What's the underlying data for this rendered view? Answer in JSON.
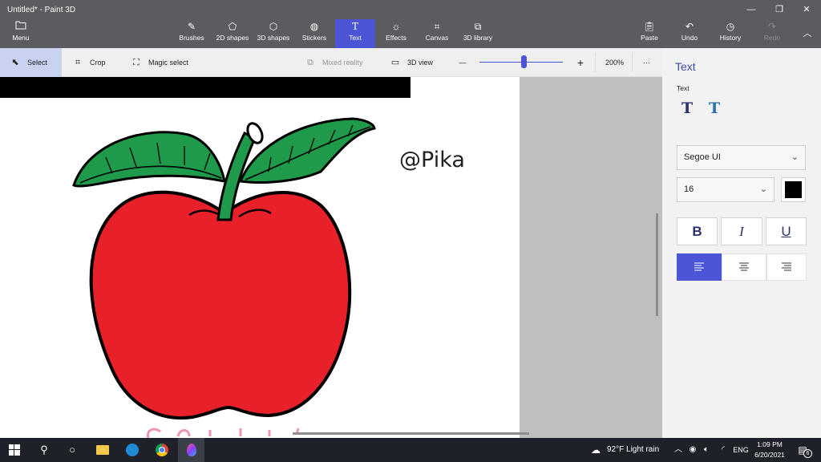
{
  "app": {
    "title": "Untitled* - Paint 3D"
  },
  "menu": {
    "label": "Menu",
    "icon": "folder-icon"
  },
  "tools": [
    {
      "label": "Brushes",
      "icon": "brush-icon"
    },
    {
      "label": "2D shapes",
      "icon": "shapes-2d-icon"
    },
    {
      "label": "3D shapes",
      "icon": "cube-icon"
    },
    {
      "label": "Stickers",
      "icon": "sticker-icon"
    },
    {
      "label": "Text",
      "icon": "text-icon",
      "active": true
    },
    {
      "label": "Effects",
      "icon": "sun-icon"
    },
    {
      "label": "Canvas",
      "icon": "crop-frame-icon"
    },
    {
      "label": "3D library",
      "icon": "library-icon"
    }
  ],
  "actions": [
    {
      "label": "Paste",
      "icon": "clipboard-icon"
    },
    {
      "label": "Undo",
      "icon": "undo-icon"
    },
    {
      "label": "History",
      "icon": "history-icon"
    },
    {
      "label": "Redo",
      "icon": "redo-icon",
      "disabled": true
    }
  ],
  "subtoolbar": {
    "select": "Select",
    "crop": "Crop",
    "magic_select": "Magic select",
    "mixed_reality": "Mixed reality",
    "view3d": "3D view",
    "zoom_percent": "200%",
    "zoom_minus": "—",
    "zoom_plus": "+",
    "more": "···"
  },
  "canvas": {
    "watermark": "@Pika"
  },
  "panel": {
    "title": "Text",
    "subtitle": "Text",
    "font": "Segoe UI",
    "size": "16",
    "color": "#000000",
    "bold": "B",
    "italic": "I",
    "underline": "U",
    "accent": "#4b55d6"
  },
  "taskbar": {
    "weather": "92°F  Light rain",
    "lang": "ENG",
    "time": "1:09 PM",
    "date": "6/20/2021",
    "notif": "6"
  },
  "colors": {
    "apple_red": "#e8202a",
    "leaf_green": "#1e9a4a",
    "chrome": "#5b5b60"
  }
}
